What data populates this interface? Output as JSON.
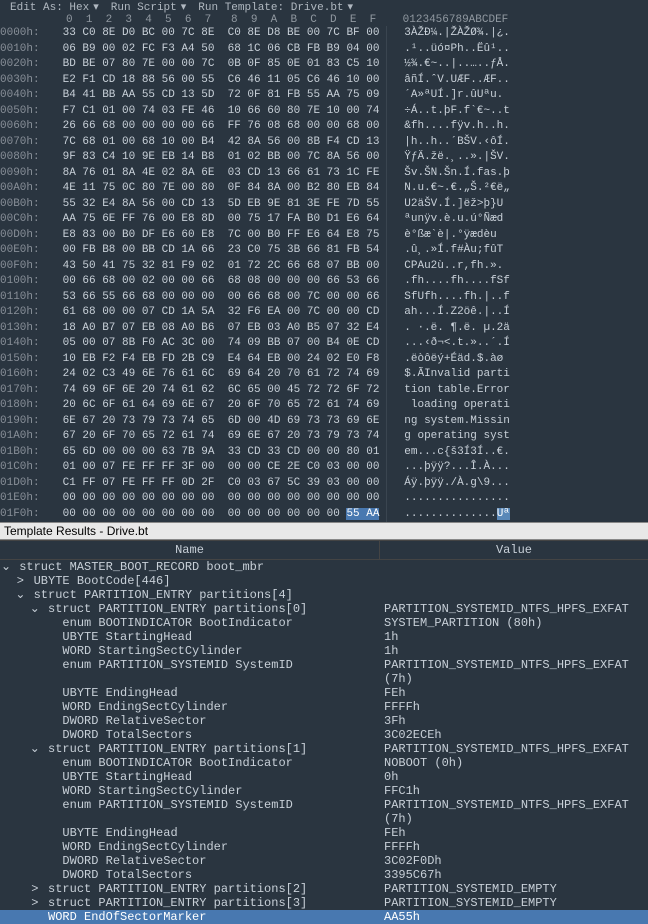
{
  "menu": {
    "editas": "Edit As: Hex",
    "runscript": "Run Script",
    "runtemplate": "Run Template: Drive.bt"
  },
  "hex_header": "          0  1  2  3  4  5  6  7   8  9  A  B  C  D  E  F    0123456789ABCDEF",
  "hex_rows": [
    {
      "o": "0000h:",
      "h": " 33 C0 8E D0 BC 00 7C 8E  C0 8E D8 BE 00 7C BF 00 ",
      "a": "  3ÀŽÐ¼.|ŽÀŽØ¾.|¿."
    },
    {
      "o": "0010h:",
      "h": " 06 B9 00 02 FC F3 A4 50  68 1C 06 CB FB B9 04 00 ",
      "a": "  .¹..üó¤Ph..Ëû¹.."
    },
    {
      "o": "0020h:",
      "h": " BD BE 07 80 7E 00 00 7C  0B 0F 85 0E 01 83 C5 10 ",
      "a": "  ½¾.€~..|..…..ƒÅ."
    },
    {
      "o": "0030h:",
      "h": " E2 F1 CD 18 88 56 00 55  C6 46 11 05 C6 46 10 00 ",
      "a": "  âñÍ.ˆV.UÆF..ÆF.."
    },
    {
      "o": "0040h:",
      "h": " B4 41 BB AA 55 CD 13 5D  72 0F 81 FB 55 AA 75 09 ",
      "a": "  ´A»ªUÍ.]r.ûUªu."
    },
    {
      "o": "0050h:",
      "h": " F7 C1 01 00 74 03 FE 46  10 66 60 80 7E 10 00 74 ",
      "a": "  ÷Á..t.þF.f`€~..t"
    },
    {
      "o": "0060h:",
      "h": " 26 66 68 00 00 00 00 66  FF 76 08 68 00 00 68 00 ",
      "a": "  &fh....fÿv.h..h."
    },
    {
      "o": "0070h:",
      "h": " 7C 68 01 00 68 10 00 B4  42 8A 56 00 8B F4 CD 13 ",
      "a": "  |h..h..´BŠV.‹ôÍ."
    },
    {
      "o": "0080h:",
      "h": " 9F 83 C4 10 9E EB 14 B8  01 02 BB 00 7C 8A 56 00 ",
      "a": "  ŸƒÄ.žë.¸..».|ŠV."
    },
    {
      "o": "0090h:",
      "h": " 8A 76 01 8A 4E 02 8A 6E  03 CD 13 66 61 73 1C FE ",
      "a": "  Šv.ŠN.Šn.Í.fas.þ"
    },
    {
      "o": "00A0h:",
      "h": " 4E 11 75 0C 80 7E 00 80  0F 84 8A 00 B2 80 EB 84 ",
      "a": "  N.u.€~.€.„Š.²€ë„"
    },
    {
      "o": "00B0h:",
      "h": " 55 32 E4 8A 56 00 CD 13  5D EB 9E 81 3E FE 7D 55 ",
      "a": "  U2äŠV.Í.]ëž>þ}U"
    },
    {
      "o": "00C0h:",
      "h": " AA 75 6E FF 76 00 E8 8D  00 75 17 FA B0 D1 E6 64 ",
      "a": "  ªunÿv.è.u.ú°Ñæd"
    },
    {
      "o": "00D0h:",
      "h": " E8 83 00 B0 DF E6 60 E8  7C 00 B0 FF E6 64 E8 75 ",
      "a": "  è°ßæ`è|.°ÿædèu"
    },
    {
      "o": "00E0h:",
      "h": " 00 FB B8 00 BB CD 1A 66  23 C0 75 3B 66 81 FB 54 ",
      "a": "  .û¸.»Í.f#Àu;fûT"
    },
    {
      "o": "00F0h:",
      "h": " 43 50 41 75 32 81 F9 02  01 72 2C 66 68 07 BB 00 ",
      "a": "  CPAu2ù..r,fh.»."
    },
    {
      "o": "0100h:",
      "h": " 00 66 68 00 02 00 00 66  68 08 00 00 00 66 53 66 ",
      "a": "  .fh....fh....fSf"
    },
    {
      "o": "0110h:",
      "h": " 53 66 55 66 68 00 00 00  00 66 68 00 7C 00 00 66 ",
      "a": "  SfUfh....fh.|..f"
    },
    {
      "o": "0120h:",
      "h": " 61 68 00 00 07 CD 1A 5A  32 F6 EA 00 7C 00 00 CD ",
      "a": "  ah...Í.Z2öê.|..Í"
    },
    {
      "o": "0130h:",
      "h": " 18 A0 B7 07 EB 08 A0 B6  07 EB 03 A0 B5 07 32 E4 ",
      "a": "  . ·.ë. ¶.ë. µ.2ä"
    },
    {
      "o": "0140h:",
      "h": " 05 00 07 8B F0 AC 3C 00  74 09 BB 07 00 B4 0E CD ",
      "a": "  ...‹ð¬<.t.»..´.Í"
    },
    {
      "o": "0150h:",
      "h": " 10 EB F2 F4 EB FD 2B C9  E4 64 EB 00 24 02 E0 F8 ",
      "a": "  .ëòôëý+Éäd.$.àø"
    },
    {
      "o": "0160h:",
      "h": " 24 02 C3 49 6E 76 61 6C  69 64 20 70 61 72 74 69 ",
      "a": "  $.ÃInvalid parti"
    },
    {
      "o": "0170h:",
      "h": " 74 69 6F 6E 20 74 61 62  6C 65 00 45 72 72 6F 72 ",
      "a": "  tion table.Error"
    },
    {
      "o": "0180h:",
      "h": " 20 6C 6F 61 64 69 6E 67  20 6F 70 65 72 61 74 69 ",
      "a": "   loading operati"
    },
    {
      "o": "0190h:",
      "h": " 6E 67 20 73 79 73 74 65  6D 00 4D 69 73 73 69 6E ",
      "a": "  ng system.Missin"
    },
    {
      "o": "01A0h:",
      "h": " 67 20 6F 70 65 72 61 74  69 6E 67 20 73 79 73 74 ",
      "a": "  g operating syst"
    },
    {
      "o": "01B0h:",
      "h": " 65 6D 00 00 00 63 7B 9A  33 CD 33 CD 00 00 80 01 ",
      "a": "  em...c{š3Í3Í..€."
    },
    {
      "o": "01C0h:",
      "h": " 01 00 07 FE FF FF 3F 00  00 00 CE 2E C0 03 00 00 ",
      "a": "  ...þÿÿ?...Î.À..."
    },
    {
      "o": "01D0h:",
      "h": " C1 FF 07 FE FF FF 0D 2F  C0 03 67 5C 39 03 00 00 ",
      "a": "  Áÿ.þÿÿ./À.g\\9..."
    },
    {
      "o": "01E0h:",
      "h": " 00 00 00 00 00 00 00 00  00 00 00 00 00 00 00 00 ",
      "a": "  ................"
    }
  ],
  "last_hex_row": {
    "o": "01F0h:",
    "h_pre": " 00 00 00 00 00 00 00 00  00 00 00 00 00 00 ",
    "h_sel": "55 AA",
    "a_pre": "  ..............",
    "a_sel": "Uª"
  },
  "pane_title": "Template Results - Drive.bt",
  "tree_cols": {
    "name": "Name",
    "value": "Value"
  },
  "tree": [
    {
      "i": 0,
      "exp": "v",
      "n": "struct MASTER_BOOT_RECORD boot_mbr",
      "v": ""
    },
    {
      "i": 1,
      "exp": ">",
      "n": "UBYTE BootCode[446]",
      "v": ""
    },
    {
      "i": 1,
      "exp": "v",
      "n": "struct PARTITION_ENTRY partitions[4]",
      "v": ""
    },
    {
      "i": 2,
      "exp": "v",
      "n": "struct PARTITION_ENTRY partitions[0]",
      "v": "PARTITION_SYSTEMID_NTFS_HPFS_EXFAT"
    },
    {
      "i": 3,
      "exp": "",
      "n": "enum BOOTINDICATOR BootIndicator",
      "v": "SYSTEM_PARTITION (80h)"
    },
    {
      "i": 3,
      "exp": "",
      "n": "UBYTE StartingHead",
      "v": "1h"
    },
    {
      "i": 3,
      "exp": "",
      "n": "WORD StartingSectCylinder",
      "v": "1h"
    },
    {
      "i": 3,
      "exp": "",
      "n": "enum PARTITION_SYSTEMID SystemID",
      "v": "PARTITION_SYSTEMID_NTFS_HPFS_EXFAT (7h)"
    },
    {
      "i": 3,
      "exp": "",
      "n": "UBYTE EndingHead",
      "v": "FEh"
    },
    {
      "i": 3,
      "exp": "",
      "n": "WORD EndingSectCylinder",
      "v": "FFFFh"
    },
    {
      "i": 3,
      "exp": "",
      "n": "DWORD RelativeSector",
      "v": "3Fh"
    },
    {
      "i": 3,
      "exp": "",
      "n": "DWORD TotalSectors",
      "v": "3C02ECEh"
    },
    {
      "i": 2,
      "exp": "v",
      "n": "struct PARTITION_ENTRY partitions[1]",
      "v": "PARTITION_SYSTEMID_NTFS_HPFS_EXFAT"
    },
    {
      "i": 3,
      "exp": "",
      "n": "enum BOOTINDICATOR BootIndicator",
      "v": "NOBOOT (0h)"
    },
    {
      "i": 3,
      "exp": "",
      "n": "UBYTE StartingHead",
      "v": "0h"
    },
    {
      "i": 3,
      "exp": "",
      "n": "WORD StartingSectCylinder",
      "v": "FFC1h"
    },
    {
      "i": 3,
      "exp": "",
      "n": "enum PARTITION_SYSTEMID SystemID",
      "v": "PARTITION_SYSTEMID_NTFS_HPFS_EXFAT (7h)"
    },
    {
      "i": 3,
      "exp": "",
      "n": "UBYTE EndingHead",
      "v": "FEh"
    },
    {
      "i": 3,
      "exp": "",
      "n": "WORD EndingSectCylinder",
      "v": "FFFFh"
    },
    {
      "i": 3,
      "exp": "",
      "n": "DWORD RelativeSector",
      "v": "3C02F0Dh"
    },
    {
      "i": 3,
      "exp": "",
      "n": "DWORD TotalSectors",
      "v": "3395C67h"
    },
    {
      "i": 2,
      "exp": ">",
      "n": "struct PARTITION_ENTRY partitions[2]",
      "v": "PARTITION_SYSTEMID_EMPTY"
    },
    {
      "i": 2,
      "exp": ">",
      "n": "struct PARTITION_ENTRY partitions[3]",
      "v": "PARTITION_SYSTEMID_EMPTY"
    }
  ],
  "highlighted_row": {
    "i": 2,
    "exp": "",
    "n": "WORD EndOfSectorMarker",
    "v": "AA55h"
  }
}
